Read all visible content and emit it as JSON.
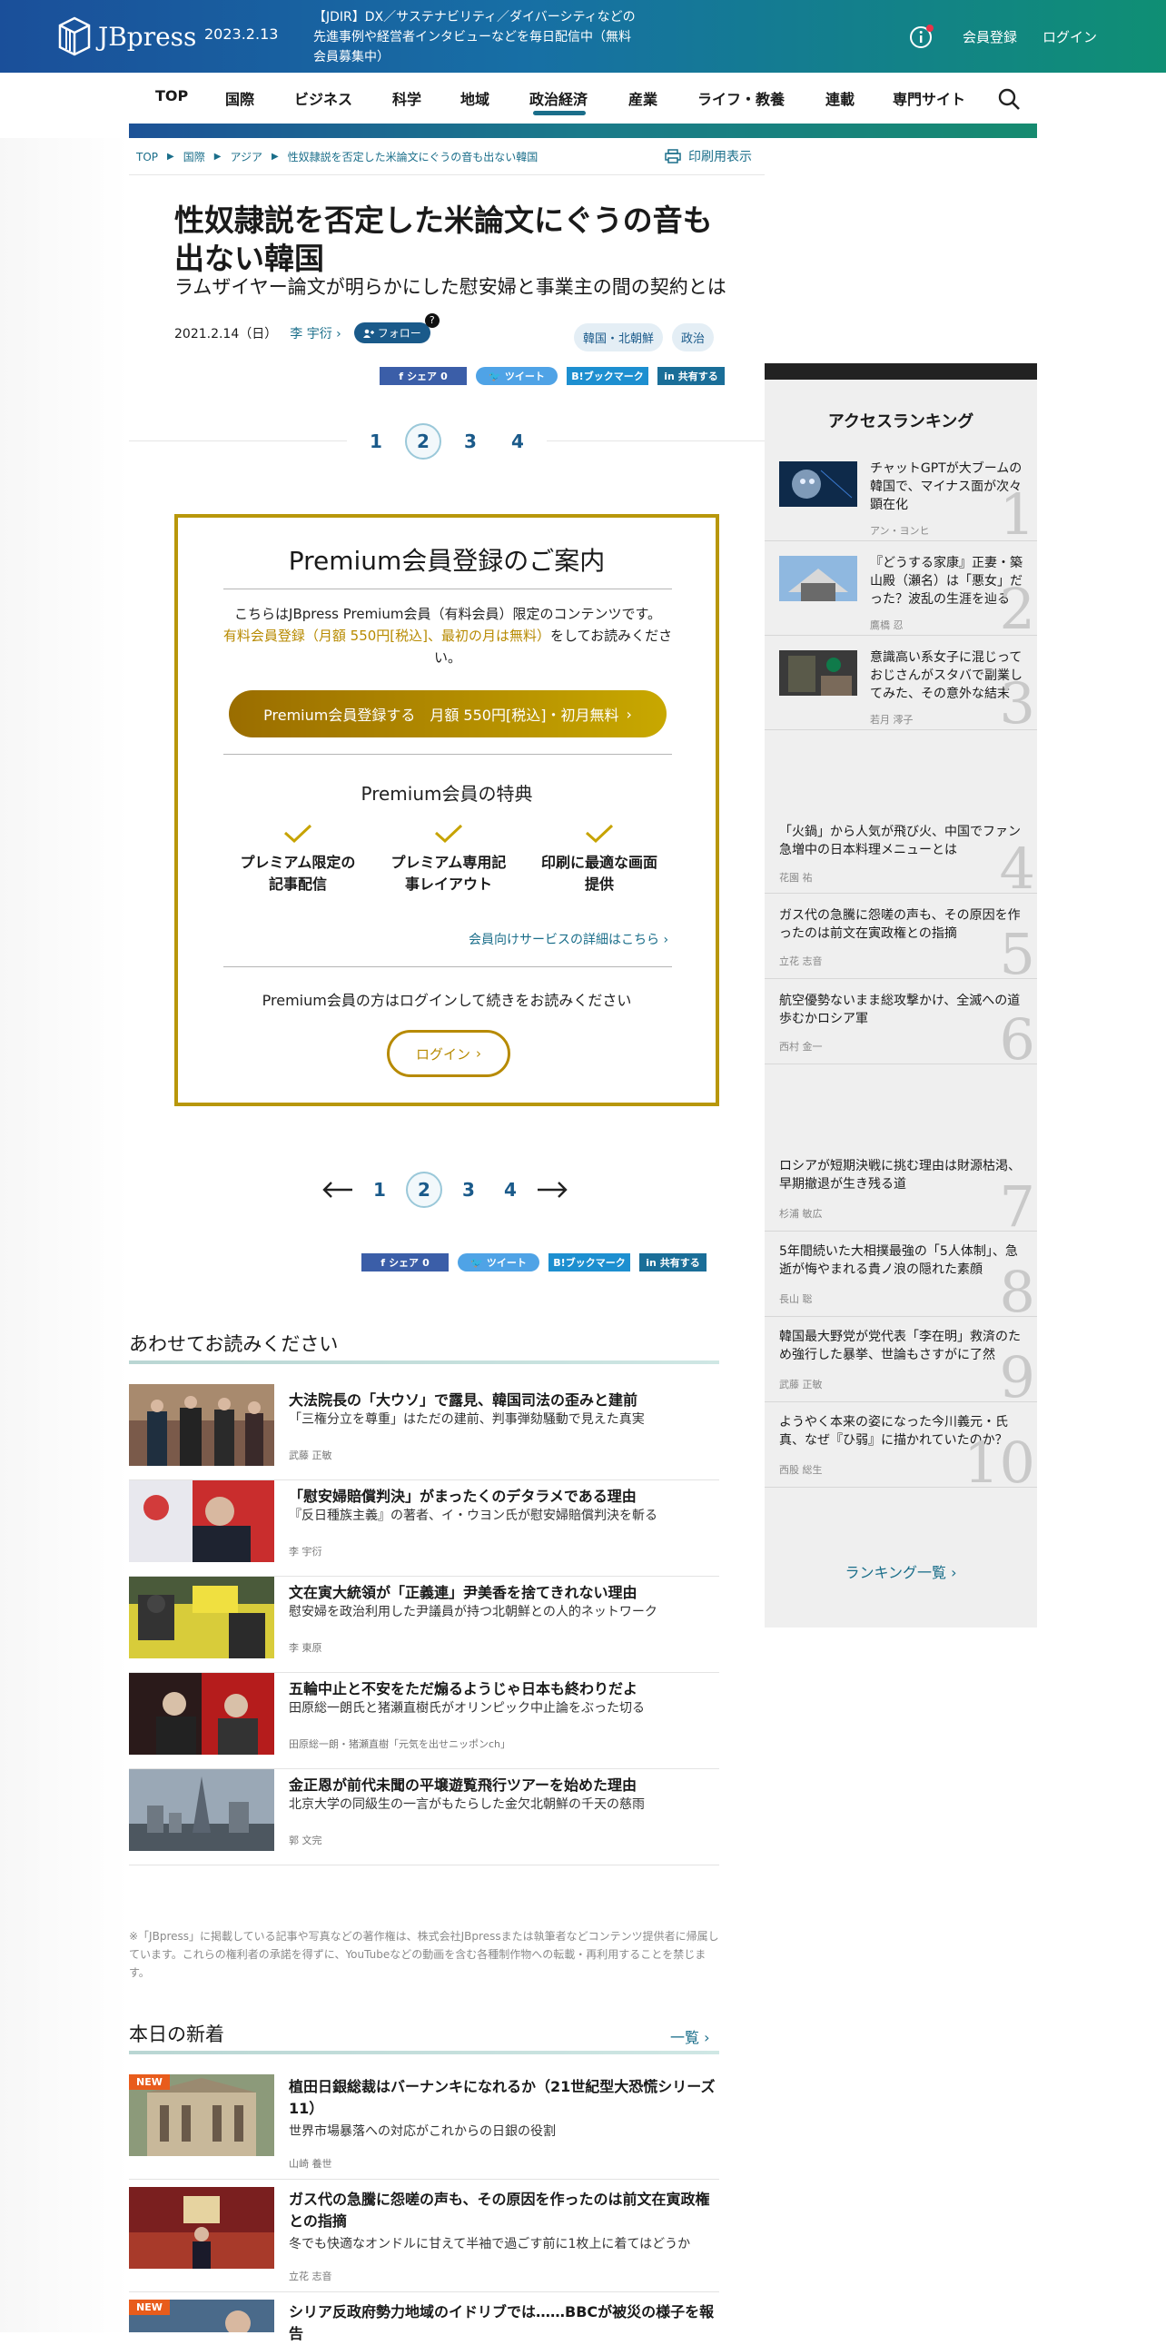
{
  "header": {
    "logo_text": "JBpress",
    "date": "2023.2.13",
    "promo": "【JDIR】DX／サステナビリティ／ダイバーシティなどの先進事例や経営者インタビューなどを毎日配信中（無料会員募集中）",
    "register": "会員登録",
    "login": "ログイン"
  },
  "nav": {
    "items": [
      "TOP",
      "国際",
      "ビジネス",
      "科学",
      "地域",
      "政治経済",
      "産業",
      "ライフ・教養",
      "連載",
      "専門サイト"
    ],
    "active": "政治経済"
  },
  "breadcrumb": [
    "TOP",
    "国際",
    "アジア",
    "性奴隷説を否定した米論文にぐうの音も出ない韓国"
  ],
  "print_label": "印刷用表示",
  "article": {
    "title": "性奴隷説を否定した米論文にぐうの音も出ない韓国",
    "subtitle": "ラムザイヤー論文が明らかにした慰安婦と事業主の間の契約とは",
    "date": "2021.2.14（日）",
    "author": "李 宇衍",
    "follow": "フォロー",
    "follow_help": "?",
    "tags": [
      "韓国・北朝鮮",
      "政治"
    ]
  },
  "share": {
    "facebook": "シェア",
    "facebook_count": "0",
    "twitter": "ツイート",
    "hatena": "B!ブックマーク",
    "linkedin": "共有する"
  },
  "pager": {
    "pages": [
      "1",
      "2",
      "3",
      "4"
    ],
    "current": "2"
  },
  "premium": {
    "title": "Premium会員登録のご案内",
    "desc_1": "こちらはJBpress Premium会員（有料会員）限定のコンテンツです。",
    "desc_link": "有料会員登録（月額 550円[税込]、最初の月は無料）",
    "desc_2": "をしてお読みください。",
    "register_button": "Premium会員登録する　月額 550円[税込]・初月無料",
    "benefits_title": "Premium会員の特典",
    "benefits": [
      "プレミアム限定の記事配信",
      "プレミアム専用記事レイアウト",
      "印刷に最適な画面提供"
    ],
    "more_link": "会員向けサービスの詳細はこちら",
    "login_text": "Premium会員の方はログインして続きをお読みください",
    "login_button": "ログイン"
  },
  "related": {
    "title": "あわせてお読みください",
    "items": [
      {
        "headline": "大法院長の「大ウソ」で露見、韓国司法の歪みと建前",
        "sub": "「三権分立を尊重」はただの建前、判事弾劾騒動で見えた真実",
        "author": "武藤 正敏"
      },
      {
        "headline": "「慰安婦賠償判決」がまったくのデタラメである理由",
        "sub": "『反日種族主義』の著者、イ・ウヨン氏が慰安婦賠償判決を斬る",
        "author": "李 宇衍"
      },
      {
        "headline": "文在寅大統領が「正義連」尹美香を捨てきれない理由",
        "sub": "慰安婦を政治利用した尹議員が持つ北朝鮮との人的ネットワーク",
        "author": "李 東原"
      },
      {
        "headline": "五輪中止と不安をただ煽るようじゃ日本も終わりだよ",
        "sub": "田原総一朗氏と猪瀬直樹氏がオリンピック中止論をぶった切る",
        "author": "田原総一朗・猪瀬直樹「元気を出せニッポンch」"
      },
      {
        "headline": "金正恩が前代未聞の平壌遊覧飛行ツアーを始めた理由",
        "sub": "北京大学の同級生の一言がもたらした金欠北朝鮮の千天の慈雨",
        "author": "郭 文完"
      }
    ]
  },
  "notice": "※「JBpress」に掲載している記事や写真などの著作権は、株式会社JBpressまたは執筆者などコンテンツ提供者に帰属しています。これらの権利者の承諾を得ずに、YouTubeなどの動画を含む各種制作物への転載・再利用することを禁じます。",
  "latest": {
    "title": "本日の新着",
    "more": "一覧",
    "badge": "NEW",
    "items": [
      {
        "headline": "植田日銀総裁はバーナンキになれるか（21世紀型大恐慌シリーズ11）",
        "sub": "世界市場暴落への対応がこれからの日銀の役割",
        "author": "山崎 養世",
        "new": true
      },
      {
        "headline": "ガス代の急騰に怨嗟の声も、その原因を作ったのは前文在寅政権との指摘",
        "sub": "冬でも快適なオンドルに甘えて半袖で過ごす前に1枚上に着てはどうか",
        "author": "立花 志音",
        "new": false
      },
      {
        "headline": "シリア反政府勢力地域のイドリブでは……BBCが被災の様子を報告",
        "sub": "",
        "author": "",
        "new": true
      }
    ]
  },
  "ranking": {
    "title": "アクセスランキング",
    "more": "ランキング一覧",
    "items": [
      {
        "rank": "1",
        "title": "チャットGPTが大ブームの韓国で、マイナス面が次々顕在化",
        "author": "アン・ヨンヒ"
      },
      {
        "rank": "2",
        "title": "『どうする家康』正妻・築山殿（瀬名）は「悪女」だった？波乱の生涯を辿る",
        "author": "鷹橋 忍"
      },
      {
        "rank": "3",
        "title": "意識高い系女子に混じっておじさんがスタバで副業してみた、その意外な結末",
        "author": "若月 澪子"
      },
      {
        "rank": "4",
        "title": "「火鍋」から人気が飛び火、中国でファン急増中の日本料理メニューとは",
        "author": "花園 祐"
      },
      {
        "rank": "5",
        "title": "ガス代の急騰に怨嗟の声も、その原因を作ったのは前文在寅政権との指摘",
        "author": "立花 志音"
      },
      {
        "rank": "6",
        "title": "航空優勢ないまま総攻撃かけ、全滅への道歩むかロシア軍",
        "author": "西村 金一"
      },
      {
        "rank": "7",
        "title": "ロシアが短期決戦に挑む理由は財源枯渇、早期撤退が生き残る道",
        "author": "杉浦 敏広"
      },
      {
        "rank": "8",
        "title": "5年間続いた大相撲最強の「5人体制」、急逝が悔やまれる貴ノ浪の隠れた素顔",
        "author": "長山 聡"
      },
      {
        "rank": "9",
        "title": "韓国最大野党が党代表「李在明」救済のため強行した暴挙、世論もさすがに了然",
        "author": "武藤 正敏"
      },
      {
        "rank": "10",
        "title": "ようやく本来の姿になった今川義元・氏真、なぜ『ひ弱』に描かれていたのか？",
        "author": "西股 総生"
      }
    ]
  }
}
